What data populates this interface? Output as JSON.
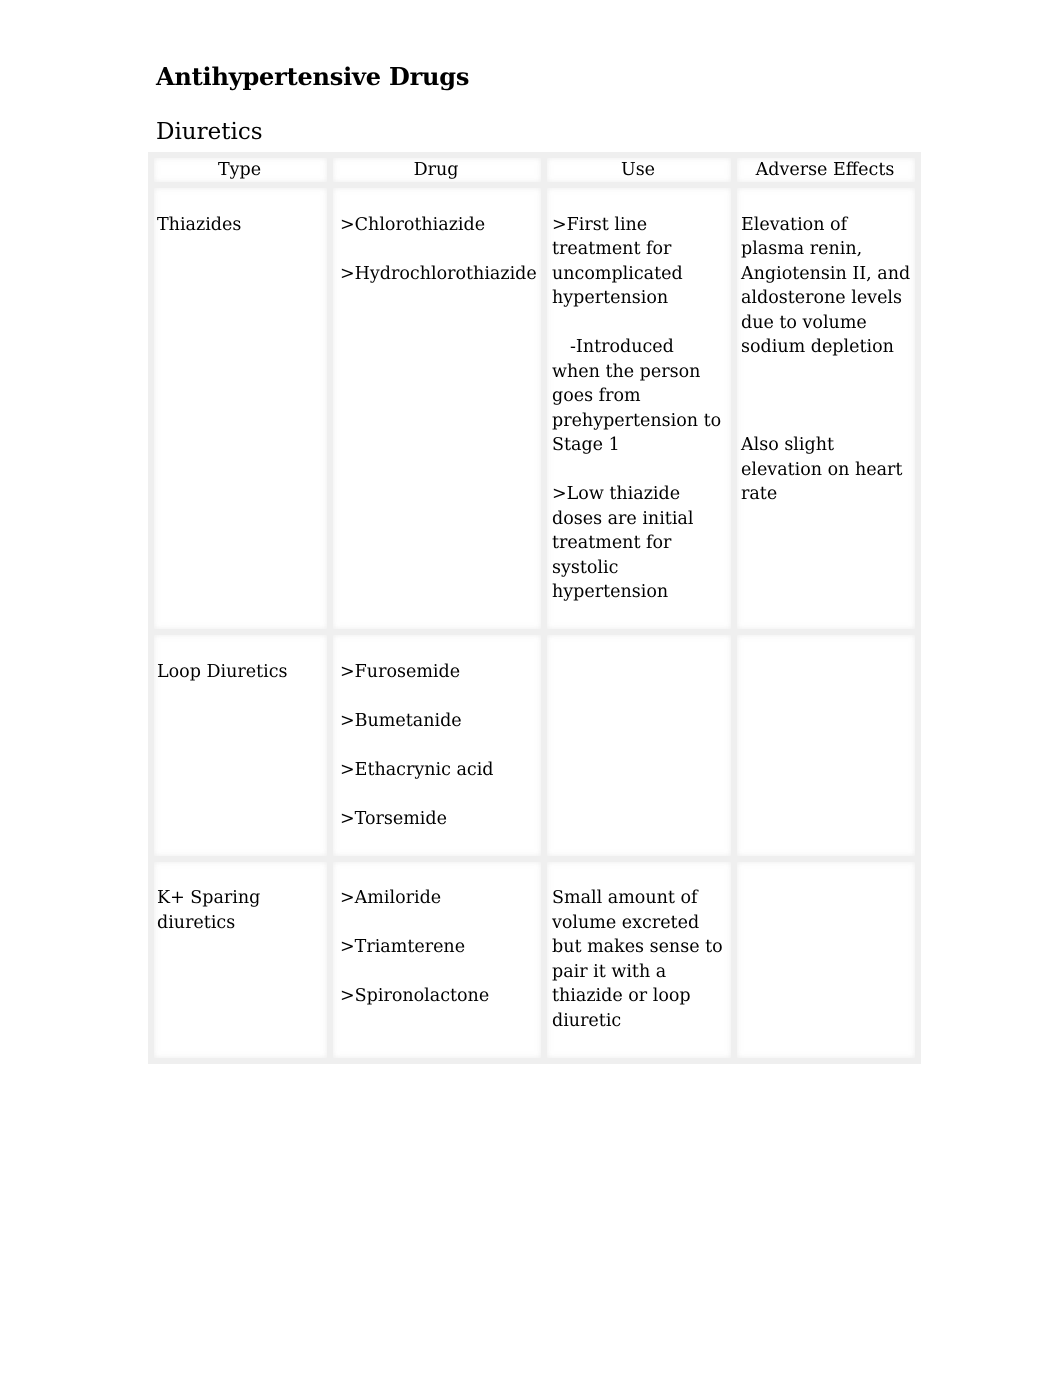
{
  "document": {
    "title": "Antihypertensive Drugs",
    "section": "Diuretics"
  },
  "table": {
    "headers": [
      "Type",
      "Drug",
      "Use",
      "Adverse Effects"
    ],
    "rows": [
      {
        "type": "Thiazides",
        "drugs": [
          ">Chlorothiazide",
          ">Hydrochlorothiazide"
        ],
        "use": [
          ">First line treatment for uncomplicated hypertension",
          "-Introduced when the person goes from prehypertension to Stage 1",
          ">Low thiazide doses are initial treatment for systolic hypertension"
        ],
        "adverse_effects": [
          "Elevation of plasma renin, Angiotensin II, and aldosterone levels due to volume sodium depletion",
          "Also slight elevation on heart rate"
        ]
      },
      {
        "type": "Loop Diuretics",
        "drugs": [
          ">Furosemide",
          ">Bumetanide",
          ">Ethacrynic acid",
          ">Torsemide"
        ],
        "use": [],
        "adverse_effects": []
      },
      {
        "type": "K+ Sparing diuretics",
        "drugs": [
          ">Amiloride",
          ">Triamterene",
          ">Spironolactone"
        ],
        "use": [
          "Small amount of volume excreted but makes sense to pair it with a thiazide or loop diuretic"
        ],
        "adverse_effects": []
      }
    ]
  }
}
